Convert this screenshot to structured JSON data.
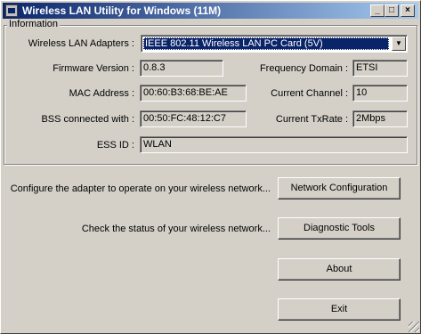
{
  "window": {
    "title": "Wireless LAN Utility for Windows (11M)",
    "minimize_glyph": "_",
    "maximize_glyph": "□",
    "close_glyph": "×"
  },
  "info": {
    "group_label": "Information",
    "adapters_label": "Wireless LAN Adapters :",
    "adapter_selected": "IEEE 802.11 Wireless LAN PC Card (5V)",
    "firmware_label": "Firmware Version :",
    "firmware_value": "0.8.3",
    "frequency_label": "Frequency Domain :",
    "frequency_value": "ETSI",
    "mac_label": "MAC Address :",
    "mac_value": "00:60:B3:68:BE:AE",
    "channel_label": "Current Channel :",
    "channel_value": "10",
    "bss_label": "BSS connected with :",
    "bss_value": "00:50:FC:48:12:C7",
    "txrate_label": "Current TxRate :",
    "txrate_value": "2Mbps",
    "essid_label": "ESS ID :",
    "essid_value": "WLAN"
  },
  "actions": {
    "configure_desc": "Configure the adapter to operate on your wireless network...",
    "configure_button": "Network Configuration",
    "status_desc": "Check the status of your wireless network...",
    "diagnostic_button": "Diagnostic Tools",
    "about_button": "About",
    "exit_button": "Exit"
  }
}
